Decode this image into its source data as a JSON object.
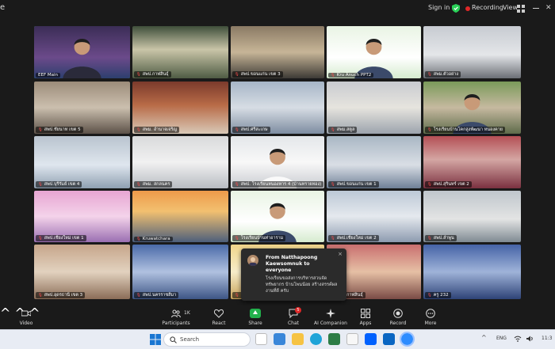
{
  "window": {
    "app_letter": "e",
    "sign_in": "Sign in",
    "recording_label": "Recording",
    "view_label": "View",
    "colors": {
      "recording_dot": "#e02828",
      "shield": "#2ad158",
      "active_speaker": "#2ad158"
    }
  },
  "grid": {
    "tiles": [
      {
        "name": "EEF Main",
        "muted": false,
        "active": true
      },
      {
        "name": "สพป.กาฬสินธุ์",
        "muted": true
      },
      {
        "name": "สพป.ขอนแก่น เขต 3",
        "muted": true
      },
      {
        "name": "Kru Anuch PPT2",
        "muted": true
      },
      {
        "name": "สพม.ตัวอย่าง",
        "muted": true
      },
      {
        "name": "สพป.ชัยนาท เขต 5",
        "muted": true
      },
      {
        "name": "สพม. อำนาจเจริญ",
        "muted": true
      },
      {
        "name": "สพป.ศรีสะเกษ",
        "muted": true
      },
      {
        "name": "สพม.สตูล",
        "muted": true
      },
      {
        "name": "โรงเรียนบ้านโคกสูงพัฒนา หนองคาย",
        "muted": true
      },
      {
        "name": "สพป.บุรีรัมย์ เขต 4",
        "muted": true
      },
      {
        "name": "สพม. สกลนคร",
        "muted": true
      },
      {
        "name": "สพป. โรงเรียนหนองหาร 4 (บ้านทรายทอง)",
        "muted": true
      },
      {
        "name": "สพป.ขอนแก่น เขต 1",
        "muted": true
      },
      {
        "name": "สพป.สุรินทร์ เขต 2",
        "muted": true
      },
      {
        "name": "สพป.เชียงใหม่ เขต 1",
        "muted": true
      },
      {
        "name": "Kruwatchara",
        "muted": true
      },
      {
        "name": "โรงเรียนบ้านท่าอาราม",
        "muted": true
      },
      {
        "name": "สพป.เชียงใหม่ เขต 2",
        "muted": true
      },
      {
        "name": "สพป.ลำพูน",
        "muted": true
      },
      {
        "name": "สพป.อุดรธานี เขต 3",
        "muted": true
      },
      {
        "name": "สพป.นครราชสีมา",
        "muted": true
      },
      {
        "name": "สพป.ยโสธร",
        "muted": true
      },
      {
        "name": "สพม.กาฬสินธุ์",
        "muted": true
      },
      {
        "name": "ครู 232",
        "muted": true
      }
    ]
  },
  "chat_notification": {
    "from": "From Natthapoong Kaewsomnuk to everyone",
    "message": "โรงเรียนขอส่งการบริหารสวนจัดทรัพยากร บ้านโพนน้อย สร้างสรรค์ผลงานที่ดี ครับ",
    "close": "×"
  },
  "toolbar": {
    "video": "Video",
    "participants": "Participants",
    "participants_count": "1K",
    "react": "React",
    "share": "Share",
    "chat": "Chat",
    "chat_badge": "5",
    "ai_companion": "AI Companion",
    "apps": "Apps",
    "record": "Record",
    "more": "More",
    "colors": {
      "share": "#22b14c",
      "badge": "#e02828"
    }
  },
  "taskbar": {
    "search_placeholder": "Search",
    "language": "ENG",
    "time": "11:3"
  }
}
